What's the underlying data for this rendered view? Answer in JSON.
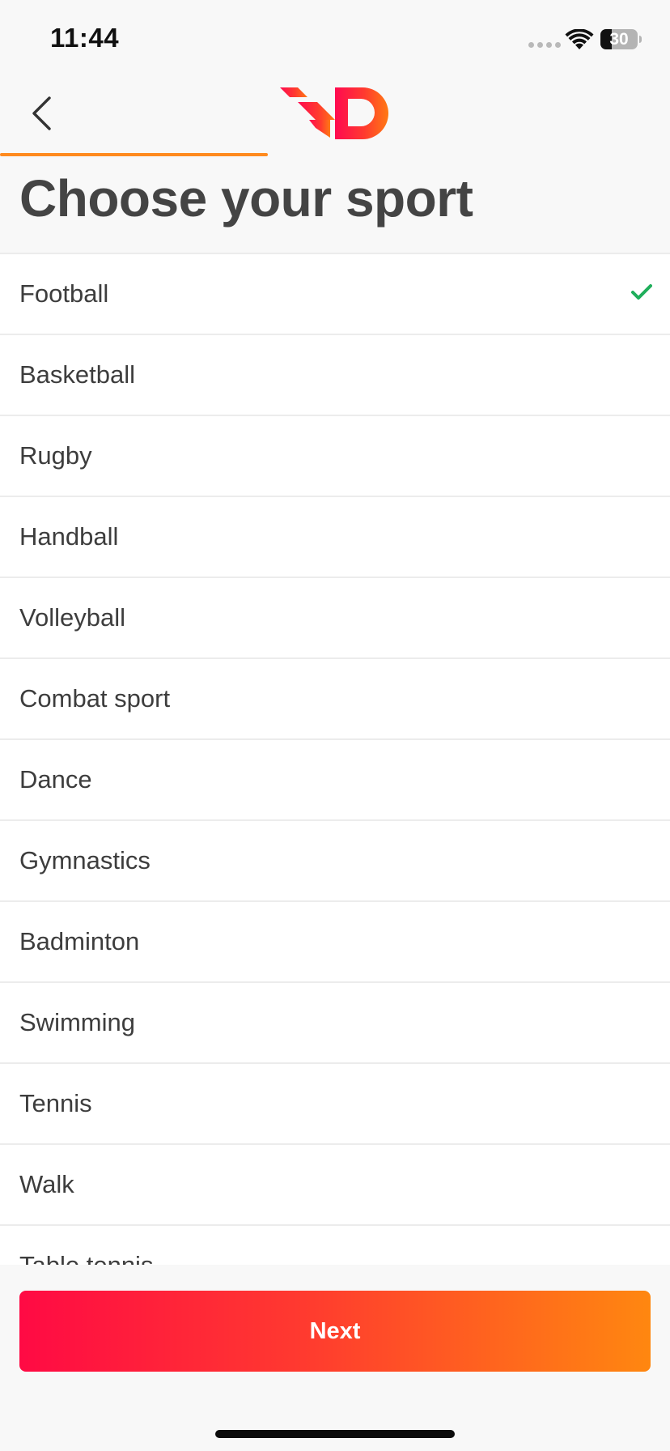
{
  "status_bar": {
    "time": "11:44",
    "battery_level": "30",
    "battery_fraction": 0.3
  },
  "header": {
    "back_icon": "chevron-left-icon",
    "logo_icon": "brand-logo-icon",
    "progress_fraction": 0.4,
    "accent_color": "#ff8a1e"
  },
  "page_title": "Choose your sport",
  "sports": [
    {
      "label": "Football",
      "selected": true
    },
    {
      "label": "Basketball",
      "selected": false
    },
    {
      "label": "Rugby",
      "selected": false
    },
    {
      "label": "Handball",
      "selected": false
    },
    {
      "label": "Volleyball",
      "selected": false
    },
    {
      "label": "Combat sport",
      "selected": false
    },
    {
      "label": "Dance",
      "selected": false
    },
    {
      "label": "Gymnastics",
      "selected": false
    },
    {
      "label": "Badminton",
      "selected": false
    },
    {
      "label": "Swimming",
      "selected": false
    },
    {
      "label": "Tennis",
      "selected": false
    },
    {
      "label": "Walk",
      "selected": false
    },
    {
      "label": "Table tennis",
      "selected": false
    }
  ],
  "selected_check_color": "#1fae5b",
  "next_button": {
    "label": "Next",
    "gradient_start": "#ff0a44",
    "gradient_end": "#ff8710"
  }
}
